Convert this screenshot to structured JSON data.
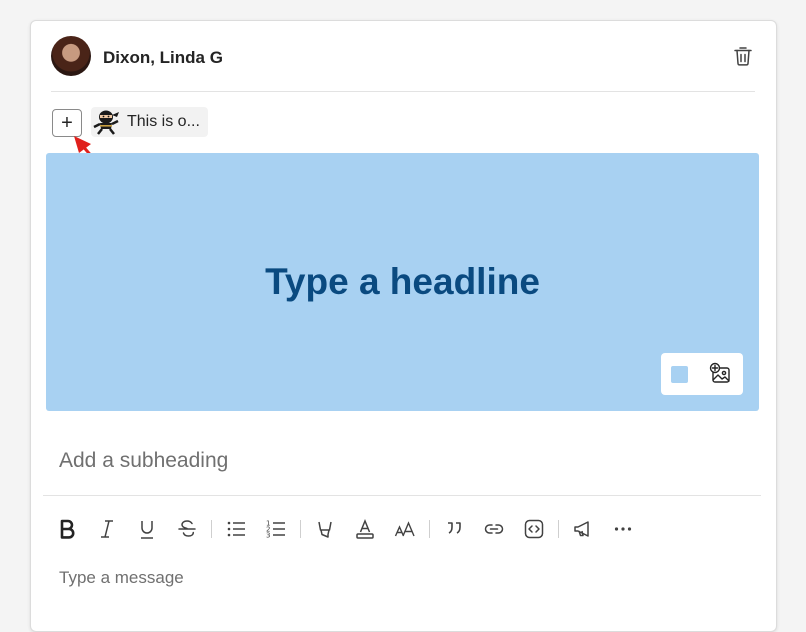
{
  "post": {
    "author": "Dixon, Linda G",
    "add_button_label": "+",
    "chip_text": "This is o..."
  },
  "banner": {
    "headline_placeholder": "Type a headline",
    "color": "#a8d1f2",
    "headline_color": "#0a4a80"
  },
  "editor": {
    "subheading_placeholder": "Add a subheading",
    "message_placeholder": "Type a message",
    "toolbar": [
      "bold",
      "italic",
      "underline",
      "strikethrough",
      "bulleted-list",
      "numbered-list",
      "highlight",
      "font-color",
      "font-size",
      "quote",
      "link",
      "code",
      "announcement",
      "more"
    ]
  }
}
